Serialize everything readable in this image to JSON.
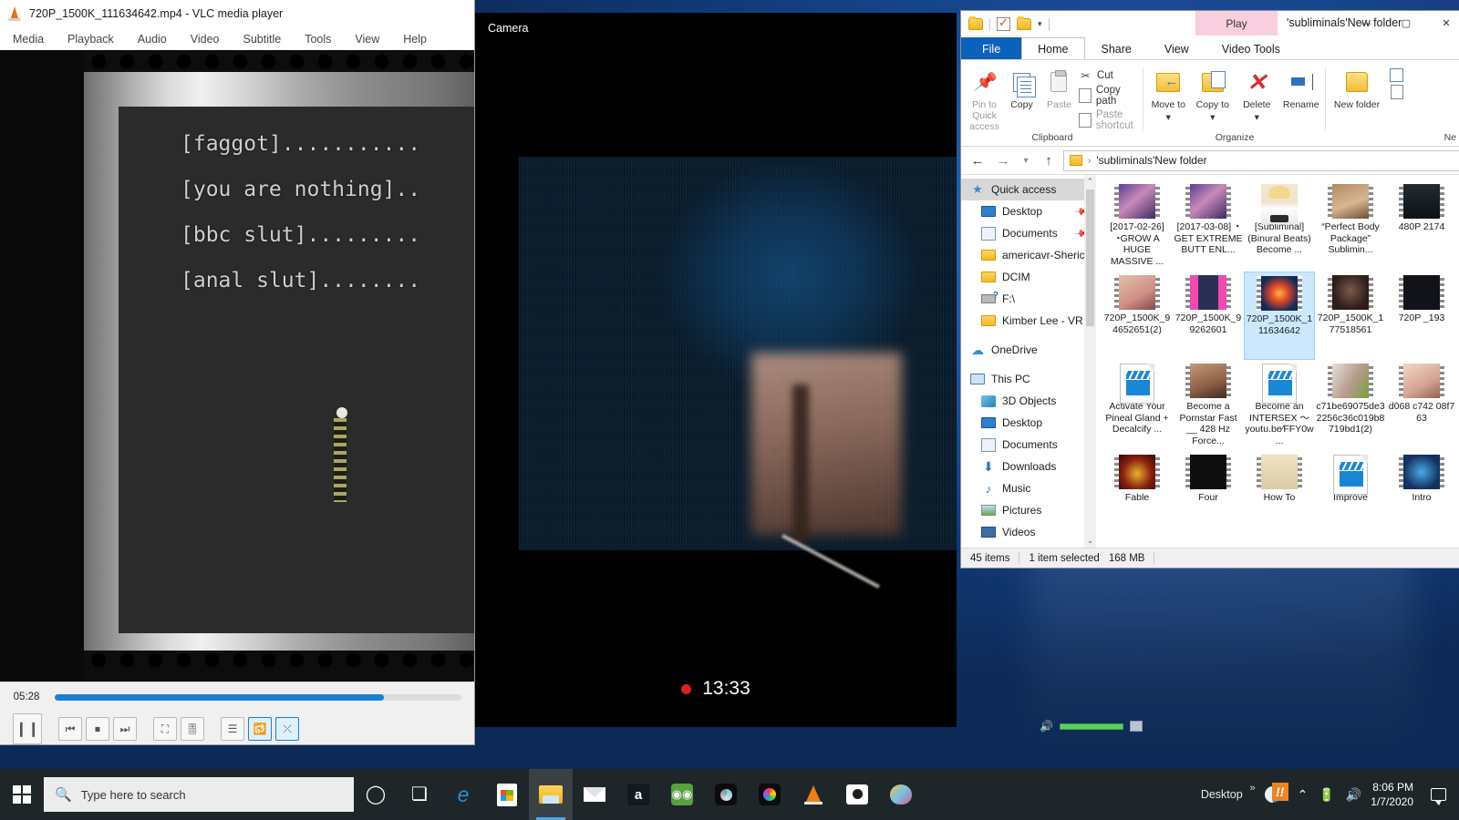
{
  "vlc": {
    "title": "720P_1500K_111634642.mp4 - VLC media player",
    "icon": "vlc-cone-icon",
    "menus": [
      "Media",
      "Playback",
      "Audio",
      "Video",
      "Subtitle",
      "Tools",
      "View",
      "Help"
    ],
    "time_elapsed": "05:28",
    "progress_percent": 81,
    "video_lines": [
      "[faggot]...........",
      "",
      "[you are nothing]..",
      "[bbc slut].........",
      "",
      "[anal slut]........"
    ],
    "buttons": [
      {
        "name": "pause-button",
        "glyph": "❙❙"
      },
      {
        "name": "previous-button",
        "glyph": "◀◀"
      },
      {
        "name": "stop-button",
        "glyph": "■"
      },
      {
        "name": "next-button",
        "glyph": "▶▶"
      },
      {
        "name": "fullscreen-button",
        "glyph": "⛶"
      },
      {
        "name": "extended-settings-button",
        "glyph": "⫿⫿⫿"
      },
      {
        "name": "playlist-button",
        "glyph": "☰"
      },
      {
        "name": "loop-button",
        "glyph": "🔁"
      },
      {
        "name": "shuffle-button",
        "glyph": "⤬"
      }
    ]
  },
  "camera": {
    "title": "Camera",
    "timer": "13:33",
    "recording": true
  },
  "explorer": {
    "window_title": "'subliminals'New folder",
    "play_tab_label": "Play",
    "quick_access_toolbar": [
      "properties-folder-icon",
      "new-folder-check-icon",
      "new-folder-icon",
      "customize-caret-icon"
    ],
    "window_controls": [
      "minimize-icon",
      "maximize-icon",
      "close-icon"
    ],
    "tabs": [
      {
        "label": "File",
        "id": "tab-file"
      },
      {
        "label": "Home",
        "id": "tab-home"
      },
      {
        "label": "Share",
        "id": "tab-share"
      },
      {
        "label": "View",
        "id": "tab-view"
      },
      {
        "label": "Video Tools",
        "id": "tab-video-tools"
      }
    ],
    "active_tab": "Home",
    "ribbon": {
      "clipboard": {
        "group_label": "Clipboard",
        "pin_label": "Pin to Quick access",
        "copy_label": "Copy",
        "paste_label": "Paste",
        "cut_label": "Cut",
        "copy_path_label": "Copy path",
        "paste_shortcut_label": "Paste shortcut"
      },
      "organize": {
        "group_label": "Organize",
        "move_to_label": "Move to",
        "copy_to_label": "Copy to",
        "delete_label": "Delete",
        "rename_label": "Rename"
      },
      "new": {
        "group_label": "Ne",
        "new_folder_label": "New folder"
      }
    },
    "address": {
      "path_text": "'subliminals'New folder",
      "back_icon": "back-arrow-icon",
      "forward_icon": "forward-arrow-icon",
      "recent_icon": "recent-locations-icon",
      "up_icon": "up-arrow-icon"
    },
    "sidebar": [
      {
        "label": "Quick access",
        "icon": "star-icon",
        "level": 0,
        "selected": true,
        "pinned": false
      },
      {
        "label": "Desktop",
        "icon": "monitor-icon",
        "level": 1,
        "selected": false,
        "pinned": true
      },
      {
        "label": "Documents",
        "icon": "documents-icon",
        "level": 1,
        "selected": false,
        "pinned": true
      },
      {
        "label": "americavr-Sheric",
        "icon": "folder-icon",
        "level": 1,
        "selected": false,
        "pinned": false
      },
      {
        "label": "DCIM",
        "icon": "folder-icon",
        "level": 1,
        "selected": false,
        "pinned": false
      },
      {
        "label": "F:\\",
        "icon": "drive-icon",
        "level": 1,
        "selected": false,
        "pinned": false
      },
      {
        "label": "Kimber Lee - VR",
        "icon": "folder-icon",
        "level": 1,
        "selected": false,
        "pinned": false
      },
      {
        "label": "OneDrive",
        "icon": "cloud-icon",
        "level": 0,
        "selected": false,
        "pinned": false
      },
      {
        "label": "This PC",
        "icon": "pc-icon",
        "level": 0,
        "selected": false,
        "pinned": false
      },
      {
        "label": "3D Objects",
        "icon": "cube-icon",
        "level": 1,
        "selected": false,
        "pinned": false
      },
      {
        "label": "Desktop",
        "icon": "monitor-icon",
        "level": 1,
        "selected": false,
        "pinned": false
      },
      {
        "label": "Documents",
        "icon": "documents-icon",
        "level": 1,
        "selected": false,
        "pinned": false
      },
      {
        "label": "Downloads",
        "icon": "download-icon",
        "level": 1,
        "selected": false,
        "pinned": false
      },
      {
        "label": "Music",
        "icon": "music-icon",
        "level": 1,
        "selected": false,
        "pinned": false
      },
      {
        "label": "Pictures",
        "icon": "pictures-icon",
        "level": 1,
        "selected": false,
        "pinned": false
      },
      {
        "label": "Videos",
        "icon": "videos-icon",
        "level": 1,
        "selected": false,
        "pinned": false
      }
    ],
    "files": [
      {
        "name": "[2017-02-26] ◔GROW A HUGE MASSIVE ...",
        "kind": "film-purple",
        "selected": false
      },
      {
        "name": "[2017-03-08] ◔ GET EXTREME BUTT ENL...",
        "kind": "film-purple",
        "selected": false
      },
      {
        "name": "[Subliminal] (Binural Beats) Become ...",
        "kind": "anime",
        "selected": false
      },
      {
        "name": "“Perfect Body Package” Sublimin...",
        "kind": "film-tan",
        "selected": false
      },
      {
        "name": "480P 2174",
        "kind": "film-dark",
        "selected": false
      },
      {
        "name": "720P_1500K_94652651(2)",
        "kind": "film-face",
        "selected": false
      },
      {
        "name": "720P_1500K_99262601",
        "kind": "film-pink",
        "selected": false
      },
      {
        "name": "720P_1500K_111634642",
        "kind": "film-orange",
        "selected": true
      },
      {
        "name": "720P_1500K_177518561",
        "kind": "film-eye",
        "selected": false
      },
      {
        "name": "720P _193",
        "kind": "film-black",
        "selected": false
      },
      {
        "name": "Activate Your Pineal Gland + Decalcify ...",
        "kind": "videofile",
        "selected": false
      },
      {
        "name": "Become a Pornstar Fast __ 428 Hz Force...",
        "kind": "film-skin",
        "selected": false
      },
      {
        "name": "Become an INTERSEX ～ youtu.be∕FFY0w...",
        "kind": "videofile",
        "selected": false
      },
      {
        "name": "c71be69075de32256c36c019b8719bd1(2)",
        "kind": "film-room",
        "selected": false
      },
      {
        "name": "d068 c742 08f7 63",
        "kind": "film-skin2",
        "selected": false
      },
      {
        "name": "Fable",
        "kind": "film-fable",
        "selected": false
      },
      {
        "name": "Four",
        "kind": "film-dark2",
        "selected": false
      },
      {
        "name": "How To",
        "kind": "film-paper",
        "selected": false
      },
      {
        "name": "Improve",
        "kind": "videofile",
        "selected": false
      },
      {
        "name": "Intro",
        "kind": "film-blue",
        "selected": false
      }
    ],
    "status": {
      "item_count": "45 items",
      "selection": "1 item selected",
      "size": "168 MB"
    }
  },
  "taskbar": {
    "search_placeholder": "Type here to search",
    "start_icon": "windows-logo-icon",
    "search_icon": "search-icon",
    "apps": [
      {
        "name": "cortana-icon",
        "id": "taskbar-cortana"
      },
      {
        "name": "task-view-icon",
        "id": "taskbar-task-view"
      },
      {
        "name": "edge-icon",
        "id": "taskbar-edge"
      },
      {
        "name": "microsoft-store-icon",
        "id": "taskbar-store"
      },
      {
        "name": "file-explorer-icon",
        "id": "taskbar-file-explorer"
      },
      {
        "name": "mail-icon",
        "id": "taskbar-mail"
      },
      {
        "name": "amazon-icon",
        "id": "taskbar-amazon"
      },
      {
        "name": "tripadvisor-icon",
        "id": "taskbar-tripadvisor"
      },
      {
        "name": "webcam-app-icon",
        "id": "taskbar-webcam"
      },
      {
        "name": "color-camera-icon",
        "id": "taskbar-color-camera"
      },
      {
        "name": "vlc-icon",
        "id": "taskbar-vlc"
      },
      {
        "name": "camera-app-icon",
        "id": "taskbar-camera"
      },
      {
        "name": "paint-icon",
        "id": "taskbar-paint"
      }
    ],
    "desktop_label": "Desktop",
    "overflow_icon": "show-hidden-icons-icon",
    "tray": [
      "internet-explorer-alert-icon",
      "chevron-up-icon",
      "battery-icon",
      "volume-icon"
    ],
    "clock_time": "8:06 PM",
    "clock_date": "1/7/2020",
    "action_center_icon": "notification-icon"
  }
}
